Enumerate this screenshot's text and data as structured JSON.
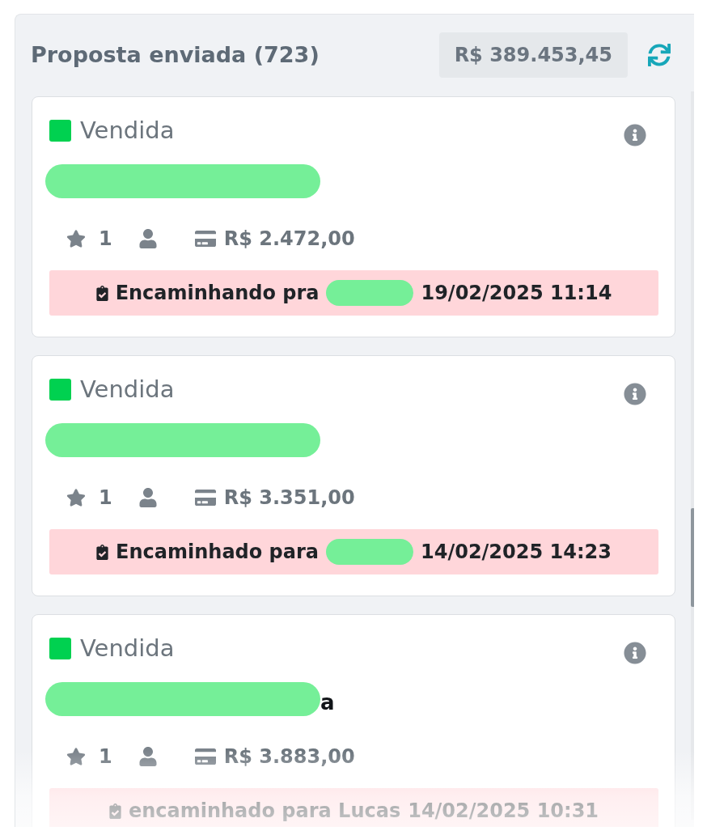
{
  "column": {
    "title": "Proposta enviada (723)",
    "total": "R$ 389.453,45"
  },
  "cards": [
    {
      "status": {
        "label": "Vendida",
        "color": "#00d150"
      },
      "name": {
        "redacted": true
      },
      "count": "1",
      "amount": "R$ 2.472,00",
      "forward": {
        "text": "Encaminhando pra",
        "recipient_redacted": true,
        "date": "19/02/2025 11:14"
      }
    },
    {
      "status": {
        "label": "Vendida",
        "color": "#00d150"
      },
      "name": {
        "redacted": true
      },
      "count": "1",
      "amount": "R$ 3.351,00",
      "forward": {
        "text": "Encaminhado para",
        "recipient_redacted": true,
        "date": "14/02/2025 14:23"
      }
    },
    {
      "status": {
        "label": "Vendida",
        "color": "#00d150"
      },
      "name": {
        "redacted": true,
        "visible_text": "a"
      },
      "count": "1",
      "amount": "R$ 3.883,00",
      "forward": {
        "text": "encaminhado para Lucas",
        "recipient_redacted": false,
        "date": "14/02/2025 10:31"
      }
    }
  ]
}
